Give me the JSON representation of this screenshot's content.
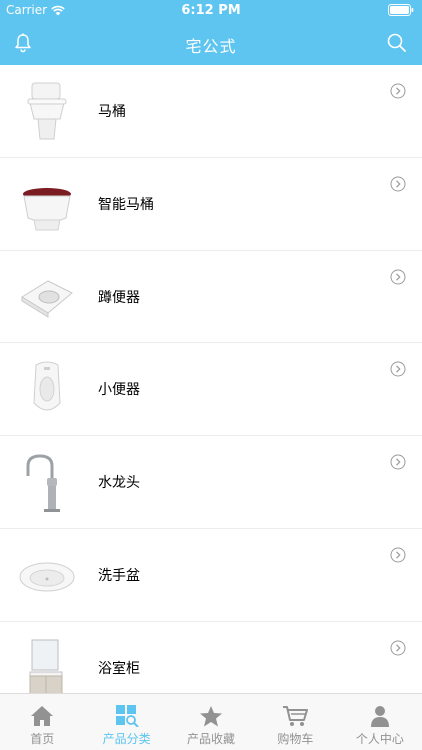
{
  "status_bar": {
    "carrier": "Carrier",
    "time": "6:12 PM"
  },
  "navbar": {
    "title": "宅公式",
    "left_icon": "bell-icon",
    "right_icon": "search-icon"
  },
  "products": [
    {
      "label": "马桶",
      "icon": "toilet-image"
    },
    {
      "label": "智能马桶",
      "icon": "smart-toilet-image"
    },
    {
      "label": "蹲便器",
      "icon": "squat-toilet-image"
    },
    {
      "label": "小便器",
      "icon": "urinal-image"
    },
    {
      "label": "水龙头",
      "icon": "faucet-image"
    },
    {
      "label": "洗手盆",
      "icon": "wash-basin-image"
    },
    {
      "label": "浴室柜",
      "icon": "bathroom-cabinet-image"
    }
  ],
  "tabbar": {
    "items": [
      {
        "label": "首页",
        "icon": "home-icon"
      },
      {
        "label": "产品分类",
        "icon": "category-icon"
      },
      {
        "label": "产品收藏",
        "icon": "star-icon"
      },
      {
        "label": "购物车",
        "icon": "cart-icon"
      },
      {
        "label": "个人中心",
        "icon": "person-icon"
      }
    ],
    "active": "产品分类"
  },
  "colors": {
    "accent": "#5ec4f0",
    "inactive": "#929292"
  }
}
